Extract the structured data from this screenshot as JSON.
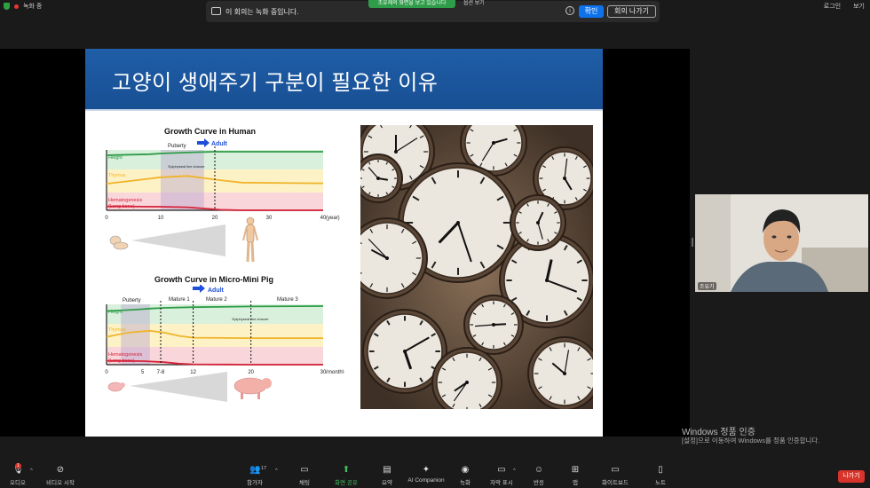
{
  "topbar": {
    "recording_label": "녹화 중",
    "login_label": "로그인",
    "view_label": "보기",
    "sharing_notice": "조유제의 화면을 보고 있습니다",
    "view_options": "옵션 보기"
  },
  "recording_banner": {
    "message": "이 회의는 녹화 중입니다.",
    "ok_label": "확인",
    "leave_label": "회의 나가기"
  },
  "slide": {
    "title": "고양이 생애주기 구분이 필요한 이유",
    "chart_data": [
      {
        "type": "area",
        "title": "Growth Curve in Human",
        "xlabel": "(year)",
        "x_ticks": [
          "0",
          "10",
          "20",
          "30",
          "40"
        ],
        "x_range": [
          0,
          40
        ],
        "series": [
          {
            "name": "Height",
            "x": [
              0,
              8,
              10,
              16,
              20,
              30,
              40
            ],
            "y": [
              0.8,
              0.86,
              0.9,
              0.97,
              1.0,
              1.0,
              1.0
            ]
          },
          {
            "name": "Thymus",
            "x": [
              0,
              5,
              10,
              15,
              20,
              25,
              30,
              40
            ],
            "y": [
              0.38,
              0.52,
              0.66,
              0.72,
              0.56,
              0.43,
              0.42,
              0.4
            ]
          },
          {
            "name": "Hematogenesis (Long bone)",
            "x": [
              0,
              10,
              15,
              18,
              21,
              25,
              40
            ],
            "y": [
              0.22,
              0.2,
              0.17,
              0.1,
              0.03,
              0.0,
              0.0
            ]
          }
        ],
        "annotations": [
          "Puberty",
          "Epiphyseal line closure",
          "Adult"
        ],
        "colors": {
          "Height": "#2e9c48",
          "Thymus": "#f0b429",
          "Hematogenesis (Long bone)": "#d6243a"
        }
      },
      {
        "type": "area",
        "title": "Growth Curve in Micro-Mini Pig",
        "xlabel": "(month)",
        "x_ticks": [
          "0",
          "5",
          "7-8",
          "12",
          "20",
          "30"
        ],
        "x_range": [
          0,
          30
        ],
        "series": [
          {
            "name": "Height",
            "x": [
              0,
              4,
              6,
              8,
              12,
              20,
              30
            ],
            "y": [
              0.72,
              0.8,
              0.86,
              0.9,
              0.94,
              0.98,
              1.0
            ]
          },
          {
            "name": "Thymus",
            "x": [
              0,
              3,
              6,
              8,
              10,
              12,
              20,
              30
            ],
            "y": [
              0.44,
              0.62,
              0.7,
              0.62,
              0.48,
              0.4,
              0.38,
              0.38
            ]
          },
          {
            "name": "Hematogenesis (Long bone)",
            "x": [
              0,
              5,
              8,
              10,
              12,
              20,
              30
            ],
            "y": [
              0.22,
              0.2,
              0.14,
              0.06,
              0.02,
              0.0,
              0.0
            ]
          }
        ],
        "annotations": [
          "Puberty",
          "Mature 1",
          "Mature 2",
          "Mature 3",
          "Epiphyseal line closure",
          "Adult"
        ],
        "colors": {
          "Height": "#2e9c48",
          "Thymus": "#f0b429",
          "Hematogenesis (Long bone)": "#d6243a"
        }
      }
    ]
  },
  "participant": {
    "name": "조유기"
  },
  "watermark": {
    "line1": "Windows 정품 인증",
    "line2": "[설정]으로 이동하여 Windows를 정품 인증합니다."
  },
  "toolbar": {
    "audio": "오디오",
    "audio_badge": "1",
    "video": "비디오 시작",
    "participants": "참가자",
    "participants_count": "17",
    "chat": "채팅",
    "share": "화면 공유",
    "summary": "요약",
    "ai": "AI Companion",
    "record": "녹화",
    "captions": "자막 표시",
    "reactions": "반응",
    "apps": "앱",
    "whiteboard": "화이트보드",
    "notes": "노트",
    "leave": "나가기"
  }
}
